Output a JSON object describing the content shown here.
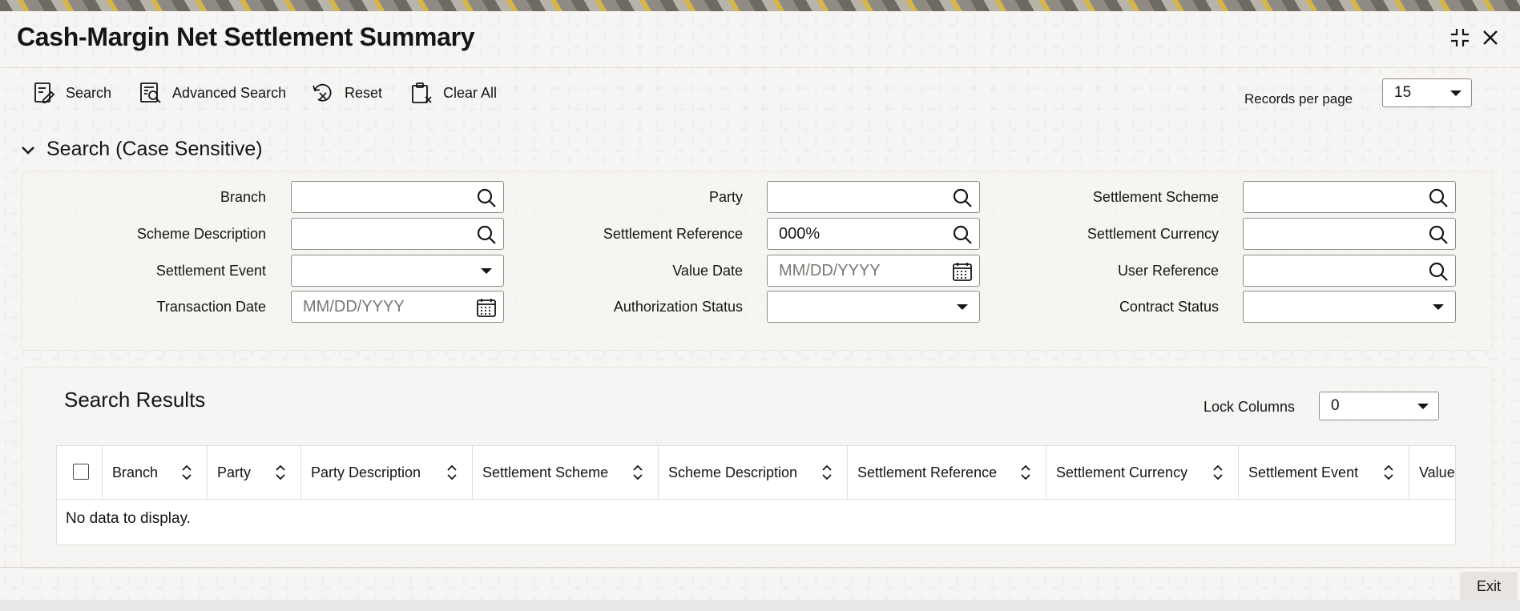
{
  "window": {
    "title": "Cash-Margin Net Settlement Summary",
    "controls": [
      "collapse-icon",
      "close-icon"
    ]
  },
  "toolbar": {
    "search_label": "Search",
    "advanced_search_label": "Advanced Search",
    "reset_label": "Reset",
    "clear_all_label": "Clear All",
    "records_per_page_label": "Records per page",
    "records_per_page_value": "15"
  },
  "search_section": {
    "title": "Search (Case Sensitive)",
    "fields": {
      "branch": {
        "label": "Branch",
        "value": "",
        "icon": "search-icon"
      },
      "scheme_description": {
        "label": "Scheme Description",
        "value": "",
        "icon": "search-icon"
      },
      "settlement_event": {
        "label": "Settlement Event",
        "value": "",
        "icon": "dropdown-icon"
      },
      "transaction_date": {
        "label": "Transaction Date",
        "value": "",
        "placeholder": "MM/DD/YYYY",
        "icon": "calendar-icon"
      },
      "party": {
        "label": "Party",
        "value": "",
        "icon": "search-icon"
      },
      "settlement_reference": {
        "label": "Settlement Reference",
        "value": "000%",
        "icon": "search-icon"
      },
      "value_date": {
        "label": "Value Date",
        "value": "",
        "placeholder": "MM/DD/YYYY",
        "icon": "calendar-icon"
      },
      "authorization_status": {
        "label": "Authorization Status",
        "value": "",
        "icon": "dropdown-icon"
      },
      "settlement_scheme": {
        "label": "Settlement Scheme",
        "value": "",
        "icon": "search-icon"
      },
      "settlement_currency": {
        "label": "Settlement Currency",
        "value": "",
        "icon": "search-icon"
      },
      "user_reference": {
        "label": "User Reference",
        "value": "",
        "icon": "search-icon"
      },
      "contract_status": {
        "label": "Contract Status",
        "value": "",
        "icon": "dropdown-icon"
      }
    }
  },
  "results": {
    "title": "Search Results",
    "lock_columns_label": "Lock Columns",
    "lock_columns_value": "0",
    "columns": [
      "Branch",
      "Party",
      "Party Description",
      "Settlement Scheme",
      "Scheme Description",
      "Settlement Reference",
      "Settlement Currency",
      "Settlement Event",
      "Value"
    ],
    "no_data_text": "No data to display."
  },
  "footer": {
    "exit_label": "Exit"
  }
}
